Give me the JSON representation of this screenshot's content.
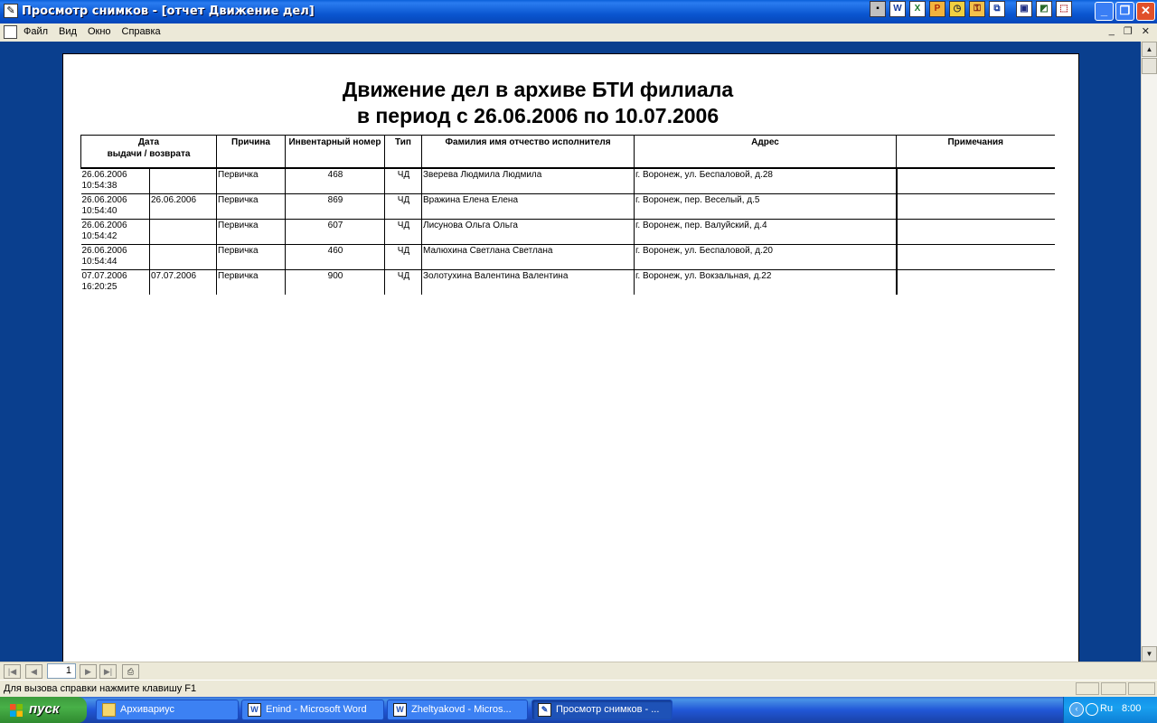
{
  "window": {
    "title": "Просмотр снимков - [отчет Движение дел]",
    "min_icon": "_",
    "max_icon": "❐",
    "close_icon": "✕"
  },
  "toolbar_icons": [
    {
      "name": "app-mini-icon",
      "glyph": "▪",
      "bg": "#c0c0c0",
      "fg": "#000"
    },
    {
      "name": "word-icon",
      "glyph": "W",
      "bg": "#ffffff",
      "fg": "#1a3fa0"
    },
    {
      "name": "excel-icon",
      "glyph": "X",
      "bg": "#ffffff",
      "fg": "#1b7a2c"
    },
    {
      "name": "powerpoint-icon",
      "glyph": "P",
      "bg": "#f3b33d",
      "fg": "#b02a0a"
    },
    {
      "name": "clock-icon",
      "glyph": "◷",
      "bg": "#f0d040",
      "fg": "#333"
    },
    {
      "name": "key-icon",
      "glyph": "⚿",
      "bg": "#f3c14a",
      "fg": "#7a1a10"
    },
    {
      "name": "dialog-icon",
      "glyph": "⧉",
      "bg": "#ffffff",
      "fg": "#1a3fa0"
    },
    {
      "name": "save-icon",
      "glyph": "▣",
      "bg": "#ffffff",
      "fg": "#1a2a80"
    },
    {
      "name": "image-icon",
      "glyph": "◩",
      "bg": "#ffffff",
      "fg": "#2a6a2a"
    },
    {
      "name": "pdf-icon",
      "glyph": "⬚",
      "bg": "#ffffff",
      "fg": "#b02020"
    }
  ],
  "menu": [
    "Файл",
    "Вид",
    "Окно",
    "Справка"
  ],
  "mdi_controls": {
    "min": "_",
    "restore": "❐",
    "close": "✕"
  },
  "report": {
    "title_line1": "Движение дел в архиве БТИ филиала",
    "title_line2": "в период с 26.06.2006 по 10.07.2006",
    "headers": {
      "date_top": "Дата",
      "date_sub": "выдачи  / возврата",
      "reason": "Причина",
      "inventory": "Инвентарный номер",
      "type": "Тип",
      "executor": "Фамилия имя отчество исполнителя",
      "address": "Адрес",
      "notes": "Примечания"
    },
    "rows": [
      {
        "issue_date": "26.06.2006",
        "issue_time": "10:54:38",
        "return_date": "",
        "reason": "Первичка",
        "inventory": "468",
        "type": "ЧД",
        "executor": "Зверева Людмила Людмила",
        "address": "г. Воронеж, ул. Беспаловой, д.28",
        "notes": ""
      },
      {
        "issue_date": "26.06.2006",
        "issue_time": "10:54:40",
        "return_date": "26.06.2006",
        "reason": "Первичка",
        "inventory": "869",
        "type": "ЧД",
        "executor": "Вражина Елена Елена",
        "address": "г. Воронеж, пер. Веселый, д.5",
        "notes": ""
      },
      {
        "issue_date": "26.06.2006",
        "issue_time": "10:54:42",
        "return_date": "",
        "reason": "Первичка",
        "inventory": "607",
        "type": "ЧД",
        "executor": "Лисунова Ольга Ольга",
        "address": "г. Воронеж, пер. Валуйский, д.4",
        "notes": ""
      },
      {
        "issue_date": "26.06.2006",
        "issue_time": "10:54:44",
        "return_date": "",
        "reason": "Первичка",
        "inventory": "460",
        "type": "ЧД",
        "executor": "Малюхина Светлана Светлана",
        "address": "г. Воронеж, ул. Беспаловой, д.20",
        "notes": ""
      },
      {
        "issue_date": "07.07.2006",
        "issue_time": "16:20:25",
        "return_date": "07.07.2006",
        "reason": "Первичка",
        "inventory": "900",
        "type": "ЧД",
        "executor": "Золотухина Валентина Валентина",
        "address": "г. Воронеж, ул. Вокзальная, д.22",
        "notes": ""
      }
    ]
  },
  "navigation": {
    "first": "|◀",
    "prev": "◀",
    "page": "1",
    "next": "▶",
    "last": "▶|",
    "print_icon": "⎙"
  },
  "scroll": {
    "up": "▲",
    "down": "▼"
  },
  "status": {
    "text": "Для вызова справки нажмите клавишу F1"
  },
  "taskbar": {
    "start_label": "пуск",
    "tasks": [
      {
        "label": "Архивариус",
        "icon": "folder-icon",
        "glyph": ""
      },
      {
        "label": "Enind - Microsoft Word",
        "icon": "word-icon",
        "glyph": "W"
      },
      {
        "label": "Zheltyakovd - Micros...",
        "icon": "word-icon",
        "glyph": "W"
      },
      {
        "label": "Просмотр снимков - ...",
        "icon": "viewer-icon",
        "glyph": "✎"
      }
    ],
    "tray": {
      "chevron": "‹",
      "lang": "Ru",
      "clock": "8:00"
    }
  },
  "colors": {
    "titlebar": "#0a56d0",
    "workspace": "#0a3f8e",
    "taskbar": "#2157d7",
    "start": "#3c9b3c"
  }
}
